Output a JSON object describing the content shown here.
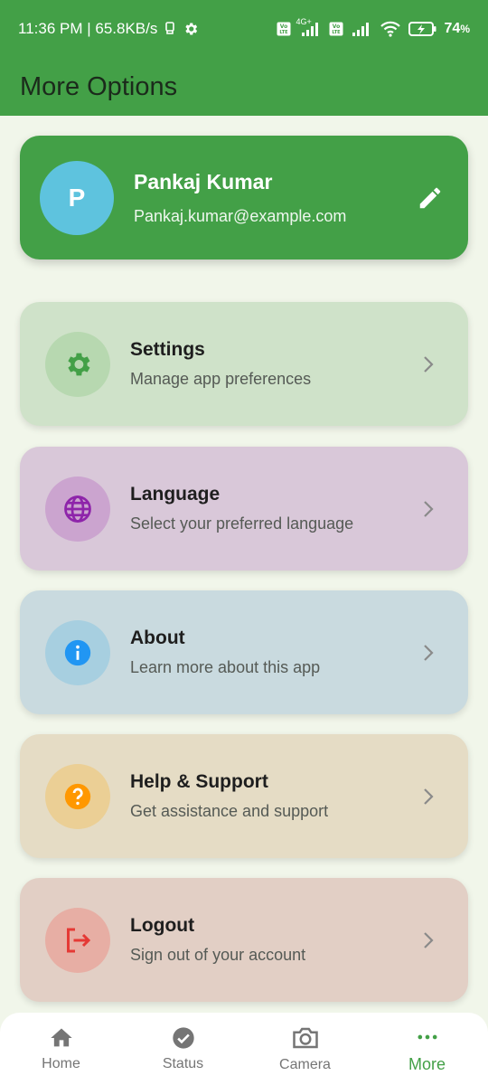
{
  "status_bar": {
    "time_speed": "11:36 PM | 65.8KB/s",
    "network_label": "4G+",
    "battery": "74",
    "battery_unit": "%"
  },
  "app_bar": {
    "title": "More Options"
  },
  "profile": {
    "initial": "P",
    "name": "Pankaj Kumar",
    "email": "Pankaj.kumar@example.com"
  },
  "options": [
    {
      "title": "Settings",
      "subtitle": "Manage app preferences",
      "icon": "gear-icon",
      "bg": "#cfe2c9",
      "icon_bg": "#b7d8b0",
      "icon_color": "#43a047"
    },
    {
      "title": "Language",
      "subtitle": "Select your preferred language",
      "icon": "globe-icon",
      "bg": "#d9c8d9",
      "icon_bg": "#cba4cf",
      "icon_color": "#8e24aa"
    },
    {
      "title": "About",
      "subtitle": "Learn more about this app",
      "icon": "info-icon",
      "bg": "#c9dadf",
      "icon_bg": "#a7cfe0",
      "icon_color": "#2196f3"
    },
    {
      "title": "Help & Support",
      "subtitle": "Get assistance and support",
      "icon": "help-icon",
      "bg": "#e5dcc5",
      "icon_bg": "#ebcf95",
      "icon_color": "#ff9800"
    },
    {
      "title": "Logout",
      "subtitle": "Sign out of your account",
      "icon": "logout-icon",
      "bg": "#e2cfc5",
      "icon_bg": "#e7aea4",
      "icon_color": "#e53935"
    }
  ],
  "bottom_nav": [
    {
      "label": "Home",
      "icon": "home-icon",
      "active": false
    },
    {
      "label": "Status",
      "icon": "check-circle-icon",
      "active": false
    },
    {
      "label": "Camera",
      "icon": "camera-icon",
      "active": false
    },
    {
      "label": "More",
      "icon": "more-icon",
      "active": true
    }
  ]
}
